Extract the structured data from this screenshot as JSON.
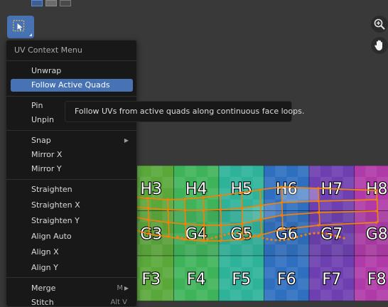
{
  "menu": {
    "title": "UV Context Menu",
    "items": [
      {
        "label": "Unwrap"
      },
      {
        "label": "Follow Active Quads"
      },
      {
        "label": "Pin"
      },
      {
        "label": "Unpin"
      },
      {
        "label": "Snap"
      },
      {
        "label": "Mirror X"
      },
      {
        "label": "Mirror Y"
      },
      {
        "label": "Straighten"
      },
      {
        "label": "Straighten X"
      },
      {
        "label": "Straighten Y"
      },
      {
        "label": "Align Auto"
      },
      {
        "label": "Align X"
      },
      {
        "label": "Align Y"
      },
      {
        "label": "Merge",
        "shortcut": "M"
      },
      {
        "label": "Stitch",
        "shortcut": "Alt V"
      }
    ]
  },
  "tooltip": {
    "text": "Follow UVs from active quads along continuous face loops."
  },
  "grid": {
    "labels_row_top": [
      "H3",
      "H4",
      "H5",
      "H6",
      "H7",
      "H8"
    ],
    "labels_row_mid": [
      "G3",
      "G4",
      "G5",
      "G6",
      "G7",
      "G8"
    ],
    "labels_row_bot": [
      "F3",
      "F4",
      "F5",
      "F6",
      "F7",
      "F8"
    ]
  },
  "icons": {
    "tool": "box-select-icon",
    "zoom": "zoom-in-icon",
    "pan": "hand-pan-icon"
  },
  "colors": {
    "accent": "#4772b3",
    "menu_bg": "#181818",
    "editor_bg": "#393939",
    "uv_edge": "#f0820a"
  }
}
